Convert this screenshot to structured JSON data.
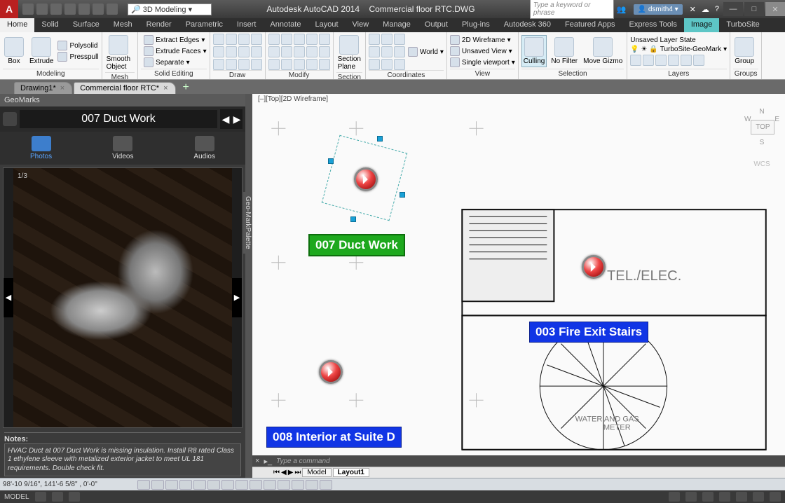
{
  "title": {
    "app": "Autodesk AutoCAD 2014",
    "file": "Commercial floor RTC.DWG"
  },
  "workspace": "3D Modeling",
  "search_placeholder": "Type a keyword or phrase",
  "user": "dsmith4",
  "ribbon_tabs": [
    "Home",
    "Solid",
    "Surface",
    "Mesh",
    "Render",
    "Parametric",
    "Insert",
    "Annotate",
    "Layout",
    "View",
    "Manage",
    "Output",
    "Plug-ins",
    "Autodesk 360",
    "Featured Apps",
    "Express Tools",
    "Image",
    "TurboSite"
  ],
  "ribbon": {
    "modeling": {
      "label": "Modeling",
      "box": "Box",
      "extrude": "Extrude",
      "polysolid": "Polysolid",
      "presspull": "Presspull"
    },
    "mesh": {
      "label": "Mesh",
      "smooth": "Smooth\nObject"
    },
    "solid_editing": {
      "label": "Solid Editing",
      "items": [
        "Extract Edges",
        "Extrude Faces",
        "Separate"
      ]
    },
    "draw": {
      "label": "Draw"
    },
    "modify": {
      "label": "Modify"
    },
    "section": {
      "label": "Section",
      "plane": "Section\nPlane"
    },
    "coordinates": {
      "label": "Coordinates"
    },
    "view": {
      "label": "View",
      "items": [
        "2D Wireframe",
        "Unsaved View",
        "Single viewport"
      ],
      "world": "World"
    },
    "selection": {
      "label": "Selection",
      "culling": "Culling",
      "nofilter": "No Filter",
      "gizmo": "Move Gizmo"
    },
    "layers": {
      "label": "Layers",
      "state": "Unsaved Layer State",
      "current": "TurboSite-GeoMark"
    },
    "groups": {
      "label": "Groups",
      "group": "Group"
    }
  },
  "file_tabs": [
    {
      "name": "Drawing1*",
      "active": false
    },
    {
      "name": "Commercial floor RTC*",
      "active": true
    }
  ],
  "palette": {
    "title": "GeoMarks",
    "side_label": "Geo-MarkPalette",
    "current": "007 Duct Work",
    "tabs": {
      "photos": "Photos",
      "videos": "Videos",
      "audios": "Audios"
    },
    "counter": "1/3",
    "notes_h": "Notes:",
    "notes": "HVAC Duct at 007 Duct Work is missing insulation. Install R8 rated Class 1 ethylene sleeve with metalized exterior jacket to meet UL 181 requirements. Double check fit."
  },
  "viewport": {
    "label": "[–][Top][2D Wireframe]",
    "compass_top": "TOP",
    "wcs": "WCS",
    "marks": {
      "m007": "007 Duct Work",
      "m003": "003 Fire Exit Stairs",
      "m008": "008 Interior at Suite D"
    },
    "room_label": "TEL./ELEC.",
    "meter_label": "WATER AND GAS\nMETER"
  },
  "command": {
    "prompt": "Type a command"
  },
  "model_tabs": {
    "model": "Model",
    "layout1": "Layout1"
  },
  "status": {
    "coords": "98'-10 9/16\", 141'-6 5/8\" , 0'-0\"",
    "mode": "MODEL"
  }
}
